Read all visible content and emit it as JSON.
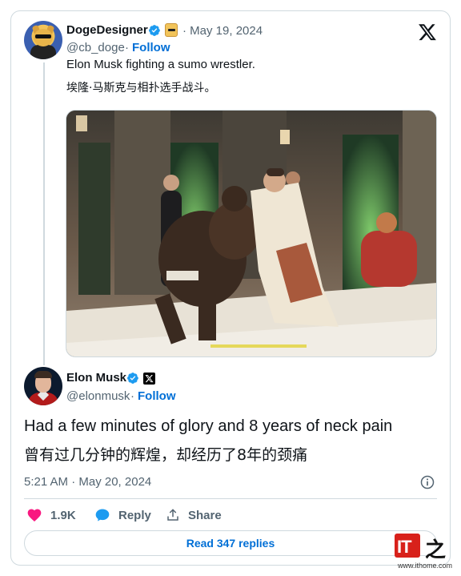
{
  "quoted": {
    "name": "DogeDesigner",
    "date": "May 19, 2024",
    "handle": "@cb_doge",
    "follow": "Follow",
    "text_en": "Elon Musk fighting a sumo wrestler.",
    "text_zh": "埃隆·马斯克与相扑选手战斗。"
  },
  "main": {
    "name": "Elon Musk",
    "handle": "@elonmusk",
    "follow": "Follow",
    "text_en": "Had a few minutes of glory and 8 years of neck pain",
    "text_zh": "曾有过几分钟的辉煌，却经历了8年的颈痛",
    "timestamp": "5:21 AM · May 20, 2024"
  },
  "actions": {
    "likes": "1.9K",
    "reply": "Reply",
    "share": "Share"
  },
  "read_replies": "Read 347 replies",
  "watermark": {
    "logo": "IT",
    "char": "之",
    "url": "www.ithome.com"
  },
  "colors": {
    "accent": "#006fd6",
    "verified": "#1d9bf0",
    "like": "#f91880",
    "text_secondary": "#536471",
    "border": "#cfd9de"
  },
  "icons": [
    "x-logo-icon",
    "verified-icon",
    "info-icon",
    "heart-icon",
    "reply-bubble-icon",
    "share-icon"
  ]
}
